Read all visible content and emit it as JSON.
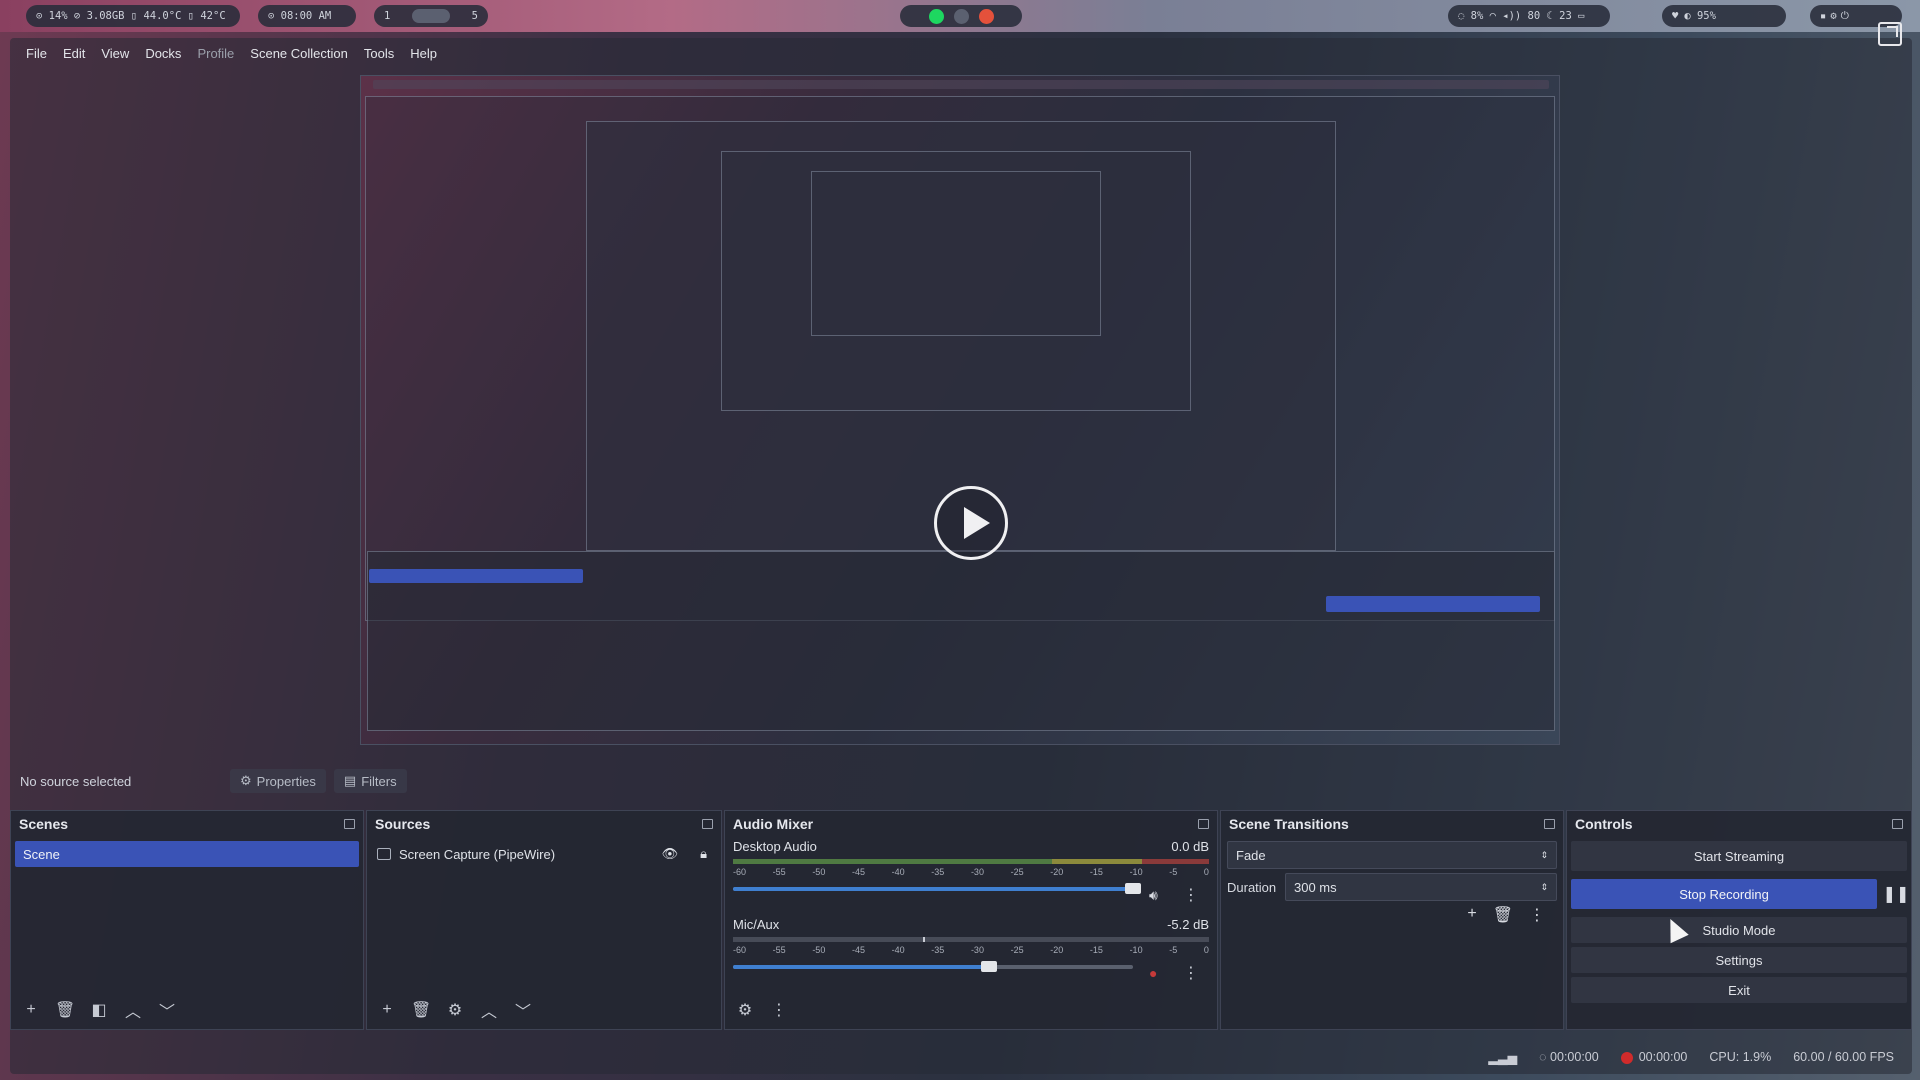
{
  "topbar": {
    "stats": "⊙ 14%  ⊘ 3.08GB  ▯ 44.0°C  ▯ 42°C",
    "clock": "⊙ 08:00 AM",
    "ws_left": "1",
    "ws_right": "5",
    "net": "◌ 8%   ◠  ◂)) 80   ☾ 23   ▭",
    "battery": "◐ 95%"
  },
  "menu": [
    "File",
    "Edit",
    "View",
    "Docks",
    "Profile",
    "Scene Collection",
    "Tools",
    "Help"
  ],
  "source_toolbar": {
    "no_source": "No source selected",
    "properties": "Properties",
    "filters": "Filters"
  },
  "scenes": {
    "title": "Scenes",
    "items": [
      "Scene"
    ]
  },
  "sources": {
    "title": "Sources",
    "items": [
      "Screen Capture (PipeWire)"
    ]
  },
  "audio_mixer": {
    "title": "Audio Mixer",
    "channels": [
      {
        "name": "Desktop Audio",
        "db": "0.0 dB",
        "volume": 1.0
      },
      {
        "name": "Mic/Aux",
        "db": "-5.2 dB",
        "volume": 0.64
      }
    ],
    "ticks": [
      "-60",
      "-55",
      "-50",
      "-45",
      "-40",
      "-35",
      "-30",
      "-25",
      "-20",
      "-15",
      "-10",
      "-5",
      "0"
    ]
  },
  "scene_transitions": {
    "title": "Scene Transitions",
    "transition": "Fade",
    "duration_label": "Duration",
    "duration_value": "300 ms"
  },
  "controls": {
    "title": "Controls",
    "start_streaming": "Start Streaming",
    "stop_recording": "Stop Recording",
    "studio_mode": "Studio Mode",
    "settings": "Settings",
    "exit": "Exit"
  },
  "status": {
    "stream_time": "00:00:00",
    "rec_time": "00:00:00",
    "cpu": "CPU: 1.9%",
    "fps": "60.00 / 60.00 FPS"
  },
  "colors": {
    "accent": "#3a53b6",
    "record": "#d12b2b"
  }
}
